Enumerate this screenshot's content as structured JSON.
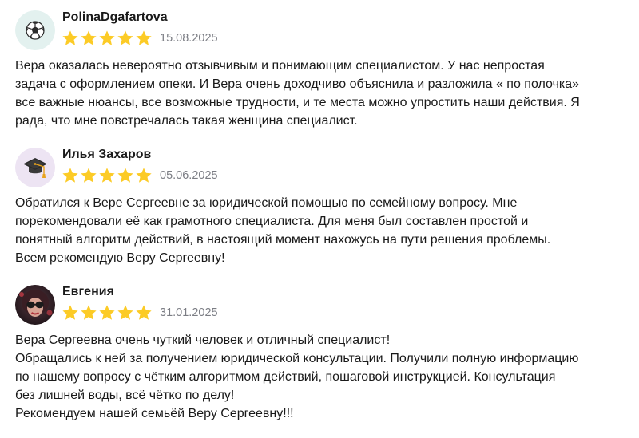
{
  "reviews": [
    {
      "author": "PolinaDgafartova",
      "avatar_icon": "soccer-ball-icon",
      "rating": 5,
      "date": "15.08.2025",
      "text_lines": [
        "Вера оказалась невероятно отзывчивым и понимающим специалистом. У нас непростая",
        "задача с оформлением опеки. И Вера очень доходчиво объяснила и разложила « по полочка»",
        "все важные нюансы, все возможные трудности, и те места можно упростить наши действия. Я",
        "рада, что мне повстречалась такая женщина специалист."
      ]
    },
    {
      "author": "Илья Захаров",
      "avatar_icon": "graduation-cap-icon",
      "rating": 5,
      "date": "05.06.2025",
      "text_lines": [
        "Обратился к Вере Сергеевне за юридической помощью по семейному вопросу. Мне",
        "порекомендовали её как грамотного специалиста. Для меня был составлен простой и",
        "понятный алгоритм действий, в настоящий момент нахожусь на пути решения проблемы.",
        "Всем рекомендую Веру Сергеевну!"
      ]
    },
    {
      "author": "Евгения",
      "avatar_icon": "user-photo-avatar",
      "rating": 5,
      "date": "31.01.2025",
      "text_lines": [
        "Вера Сергеевна очень чуткий человек и отличный специалист!",
        "Обращались к ней за получением юридической консультации. Получили полную информацию",
        "по нашему вопросу с чётким алгоритмом действий, пошаговой инструкцией. Консультация",
        "без лишней воды, всё чётко по делу!",
        "Рекомендуем нашей семьёй Веру Сергеевну!!!"
      ]
    }
  ],
  "colors": {
    "star": "#fccb26",
    "date": "#7b7d84",
    "text": "#1a1a1a",
    "avatar_bg_1": "#e3f1ef",
    "avatar_bg_2": "#ede4f3"
  }
}
